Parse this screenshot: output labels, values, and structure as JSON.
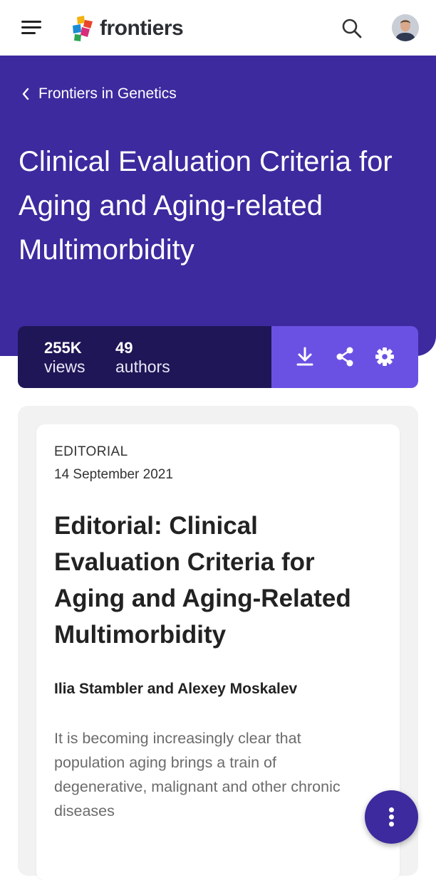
{
  "header": {
    "logo_text": "frontiers",
    "icons": [
      "menu-icon",
      "search-icon",
      "avatar"
    ]
  },
  "hero": {
    "breadcrumb": "Frontiers in Genetics",
    "title": "Clinical Evaluation Criteria for Aging and Aging-related Multimorbidity",
    "background_color": "#3d2a9e"
  },
  "stats": {
    "views_value": "255K",
    "views_label": "views",
    "authors_value": "49",
    "authors_label": "authors",
    "actions": [
      "download-icon",
      "share-icon",
      "settings-icon"
    ],
    "left_color": "#1f1657",
    "right_color": "#6b51e3"
  },
  "article": {
    "type": "EDITORIAL",
    "date": "14 September 2021",
    "title": "Editorial: Clinical Evaluation Criteria for Aging and Aging-Related Multimorbidity",
    "authors": "Ilia Stambler and Alexey Moskalev",
    "abstract": "It is becoming increasingly clear that population aging brings a train of degenerative, malignant and other chronic diseases"
  },
  "fab": {
    "icon": "more-vertical-icon",
    "color": "#3d2a9e"
  }
}
